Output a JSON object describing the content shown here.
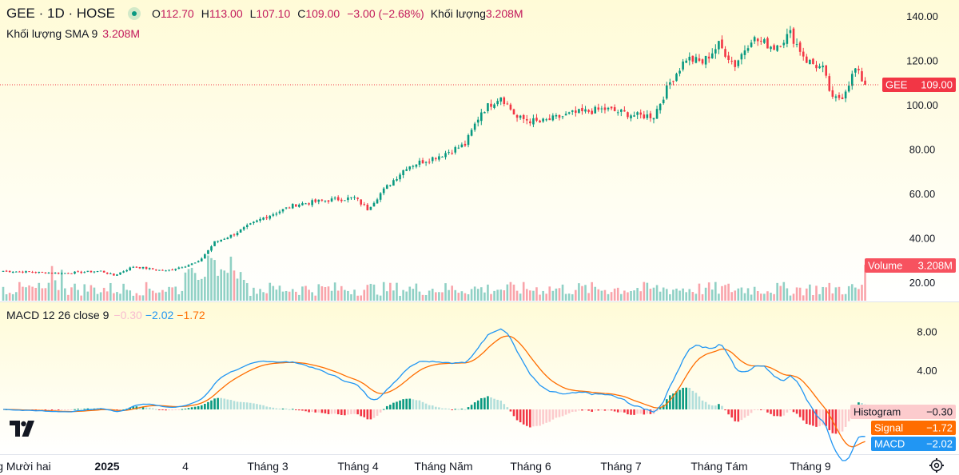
{
  "header": {
    "symbol_title": "GEE · 1D · HOSE",
    "open_label": "O",
    "open": "112.70",
    "high_label": "H",
    "high": "113.00",
    "low_label": "L",
    "low": "107.10",
    "close_label": "C",
    "close": "109.00",
    "change": "−3.00 (−2.68%)",
    "volume_label": "Khối lượng",
    "volume": "3.208M"
  },
  "volume_sma": {
    "label": "Khối lượng SMA 9",
    "value": "3.208M"
  },
  "macd_header": {
    "label": "MACD 12 26 close 9",
    "histogram": "−0.30",
    "macd": "−2.02",
    "signal": "−1.72"
  },
  "colors": {
    "up": "#089981",
    "down": "#f23645",
    "macd": "#2196f3",
    "signal": "#ff6d00",
    "bg_top": "#fffbd7"
  },
  "icons": {
    "logo": "tradingview-logo-icon",
    "settings": "gear-icon"
  },
  "chart_data": [
    {
      "type": "candlestick",
      "symbol": "GEE",
      "interval": "1D",
      "exchange": "HOSE",
      "x_tick_labels": [
        "g Mười hai",
        "2025",
        "4",
        "Tháng 3",
        "Tháng 4",
        "Tháng Năm",
        "Tháng 6",
        "Tháng 7",
        "Tháng Tám",
        "Tháng 9"
      ],
      "y_tick_labels": [
        "140.00",
        "120.00",
        "100.00",
        "80.00",
        "60.00",
        "40.00",
        "20.00"
      ],
      "ylim": [
        20,
        140
      ],
      "price_tag": {
        "label": "GEE",
        "value": "109.00"
      },
      "volume_tag": {
        "label": "Volume",
        "value": "3.208M"
      },
      "anchor_closes": [
        {
          "x": 0,
          "close": 25
        },
        {
          "x": 18,
          "close": 24
        },
        {
          "x": 30,
          "close": 25
        },
        {
          "x": 34,
          "close": 23
        },
        {
          "x": 40,
          "close": 27
        },
        {
          "x": 50,
          "close": 25
        },
        {
          "x": 60,
          "close": 29
        },
        {
          "x": 65,
          "close": 38
        },
        {
          "x": 70,
          "close": 41
        },
        {
          "x": 80,
          "close": 49
        },
        {
          "x": 90,
          "close": 55
        },
        {
          "x": 100,
          "close": 57
        },
        {
          "x": 108,
          "close": 58
        },
        {
          "x": 112,
          "close": 53
        },
        {
          "x": 116,
          "close": 60
        },
        {
          "x": 124,
          "close": 72
        },
        {
          "x": 134,
          "close": 77
        },
        {
          "x": 142,
          "close": 82
        },
        {
          "x": 147,
          "close": 97
        },
        {
          "x": 153,
          "close": 104
        },
        {
          "x": 158,
          "close": 94
        },
        {
          "x": 165,
          "close": 92
        },
        {
          "x": 175,
          "close": 96
        },
        {
          "x": 185,
          "close": 98
        },
        {
          "x": 195,
          "close": 95
        },
        {
          "x": 200,
          "close": 95
        },
        {
          "x": 205,
          "close": 110
        },
        {
          "x": 210,
          "close": 121
        },
        {
          "x": 215,
          "close": 119
        },
        {
          "x": 220,
          "close": 127
        },
        {
          "x": 225,
          "close": 118
        },
        {
          "x": 230,
          "close": 130
        },
        {
          "x": 237,
          "close": 126
        },
        {
          "x": 242,
          "close": 132
        },
        {
          "x": 247,
          "close": 120
        },
        {
          "x": 252,
          "close": 116
        },
        {
          "x": 255,
          "close": 102
        },
        {
          "x": 258,
          "close": 104
        },
        {
          "x": 262,
          "close": 116
        },
        {
          "x": 265,
          "close": 109
        }
      ]
    },
    {
      "type": "macd",
      "label": "MACD 12 26 close 9",
      "y_tick_labels": [
        "8.00",
        "4.00"
      ],
      "ylim": [
        -4,
        10
      ],
      "series": [
        {
          "name": "MACD",
          "value": "−2.02"
        },
        {
          "name": "Signal",
          "value": "−1.72"
        },
        {
          "name": "Histogram",
          "value": "−0.30"
        }
      ]
    }
  ]
}
